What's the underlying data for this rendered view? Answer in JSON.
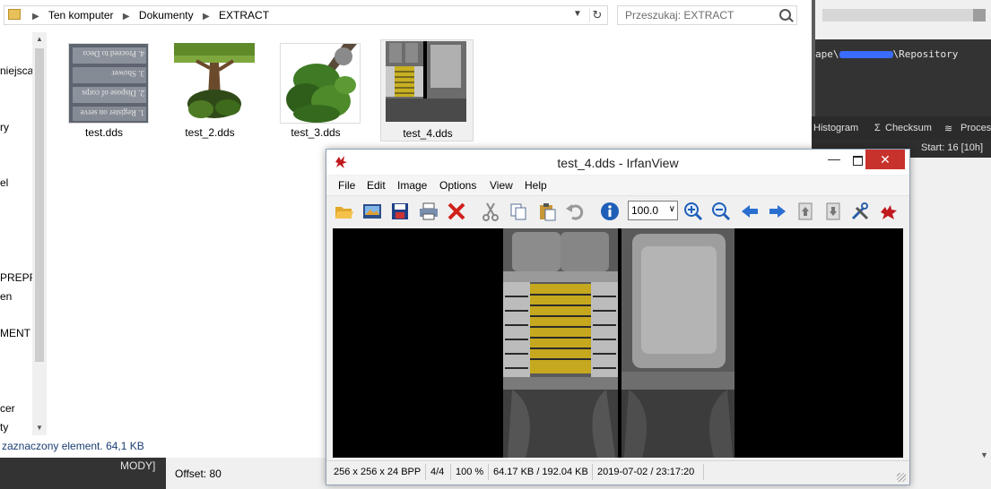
{
  "explorer": {
    "breadcrumb": [
      "Ten komputer",
      "Dokumenty",
      "EXTRACT"
    ],
    "search_placeholder": "Przeszukaj: EXTRACT",
    "nav_items": [
      "niejsca",
      "ry",
      "el",
      "PREPRO",
      "en",
      "MENT",
      "cer",
      "ty"
    ],
    "files": [
      {
        "name": "test.dds",
        "selected": false
      },
      {
        "name": "test_2.dds",
        "selected": false
      },
      {
        "name": "test_3.dds",
        "selected": false
      },
      {
        "name": "test_4.dds",
        "selected": true
      }
    ],
    "thumb_text": [
      "1. Register on serve",
      "2. Dispose of corps",
      "3. Shower",
      "4. Proceed to Deco"
    ],
    "status": "zaznaczony element. 64,1 KB"
  },
  "right_app": {
    "path_prefix": "ape\\",
    "path_suffix": "\\Repository",
    "tabs": [
      "Histogram",
      "Checksum",
      "Proces"
    ],
    "start_label": "Start: 16 [10h]"
  },
  "bottom": {
    "mody": "MODY]",
    "offset": "Offset: 80"
  },
  "irfanview": {
    "title": "test_4.dds - IrfanView",
    "minimize": "—",
    "close": "✕",
    "menu": [
      "File",
      "Edit",
      "Image",
      "Options",
      "View",
      "Help"
    ],
    "zoom": "100.0",
    "status": {
      "dimensions": "256 x 256 x 24 BPP",
      "index": "4/4",
      "zoom_pct": "100 %",
      "size": "64.17 KB / 192.04 KB",
      "date": "2019-07-02 / 23:17:20"
    }
  }
}
